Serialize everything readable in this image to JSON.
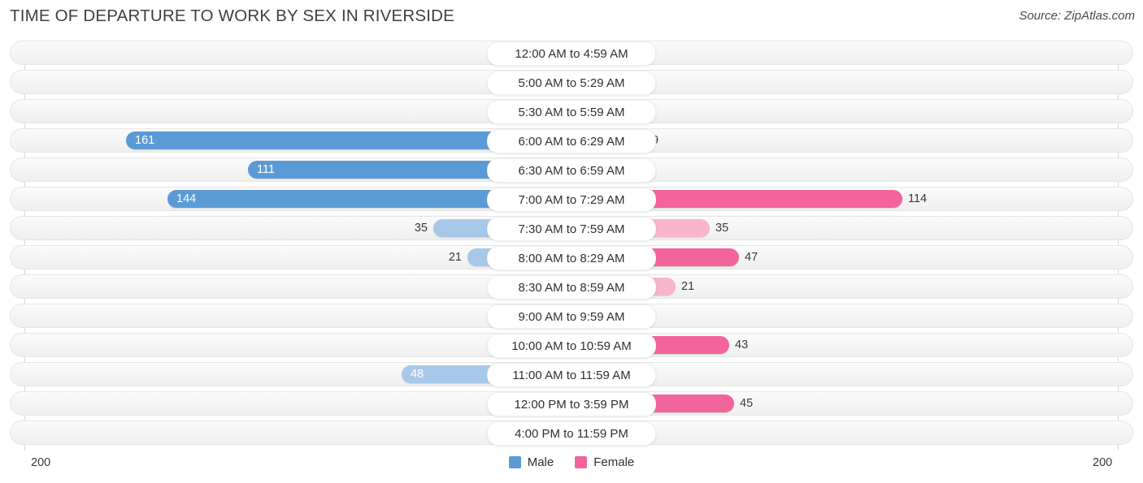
{
  "header": {
    "title": "TIME OF DEPARTURE TO WORK BY SEX IN RIVERSIDE",
    "source": "Source: ZipAtlas.com"
  },
  "axis": {
    "left_tick": "200",
    "right_tick": "200",
    "max": 200
  },
  "legend": {
    "items": [
      {
        "label": "Male",
        "color": "#5b9bd5"
      },
      {
        "label": "Female",
        "color": "#f2649b"
      }
    ]
  },
  "colors": {
    "male_strong": "#5b9bd5",
    "male_light": "#a8c8ea",
    "female_strong": "#f2649b",
    "female_light": "#f8b5cb",
    "track_bg": "#f4f4f4",
    "track_border": "#e6e6e6",
    "axis_line": "#d8d8d8",
    "text": "#3a3a3a"
  },
  "chart_data": {
    "type": "bar",
    "orientation": "horizontal-diverging",
    "title": "TIME OF DEPARTURE TO WORK BY SEX IN RIVERSIDE",
    "xlabel": "",
    "ylabel": "",
    "xlim": [
      200,
      200
    ],
    "grid": false,
    "legend_position": "bottom-center",
    "categories": [
      "12:00 AM to 4:59 AM",
      "5:00 AM to 5:29 AM",
      "5:30 AM to 5:59 AM",
      "6:00 AM to 6:29 AM",
      "6:30 AM to 6:59 AM",
      "7:00 AM to 7:29 AM",
      "7:30 AM to 7:59 AM",
      "8:00 AM to 8:29 AM",
      "8:30 AM to 8:59 AM",
      "9:00 AM to 9:59 AM",
      "10:00 AM to 10:59 AM",
      "11:00 AM to 11:59 AM",
      "12:00 PM to 3:59 PM",
      "4:00 PM to 11:59 PM"
    ],
    "series": [
      {
        "name": "Male",
        "values": [
          0,
          0,
          0,
          161,
          111,
          144,
          35,
          21,
          0,
          0,
          0,
          48,
          0,
          0
        ]
      },
      {
        "name": "Female",
        "values": [
          0,
          0,
          0,
          9,
          0,
          114,
          35,
          47,
          21,
          0,
          43,
          0,
          45,
          0
        ]
      }
    ]
  },
  "rows": [
    {
      "label": "12:00 AM to 4:59 AM",
      "male": "0",
      "female": "0"
    },
    {
      "label": "5:00 AM to 5:29 AM",
      "male": "0",
      "female": "0"
    },
    {
      "label": "5:30 AM to 5:59 AM",
      "male": "0",
      "female": "0"
    },
    {
      "label": "6:00 AM to 6:29 AM",
      "male": "161",
      "female": "9"
    },
    {
      "label": "6:30 AM to 6:59 AM",
      "male": "111",
      "female": "0"
    },
    {
      "label": "7:00 AM to 7:29 AM",
      "male": "144",
      "female": "114"
    },
    {
      "label": "7:30 AM to 7:59 AM",
      "male": "35",
      "female": "35"
    },
    {
      "label": "8:00 AM to 8:29 AM",
      "male": "21",
      "female": "47"
    },
    {
      "label": "8:30 AM to 8:59 AM",
      "male": "0",
      "female": "21"
    },
    {
      "label": "9:00 AM to 9:59 AM",
      "male": "0",
      "female": "0"
    },
    {
      "label": "10:00 AM to 10:59 AM",
      "male": "0",
      "female": "43"
    },
    {
      "label": "11:00 AM to 11:59 AM",
      "male": "48",
      "female": "0"
    },
    {
      "label": "12:00 PM to 3:59 PM",
      "male": "0",
      "female": "45"
    },
    {
      "label": "4:00 PM to 11:59 PM",
      "male": "0",
      "female": "0"
    }
  ]
}
